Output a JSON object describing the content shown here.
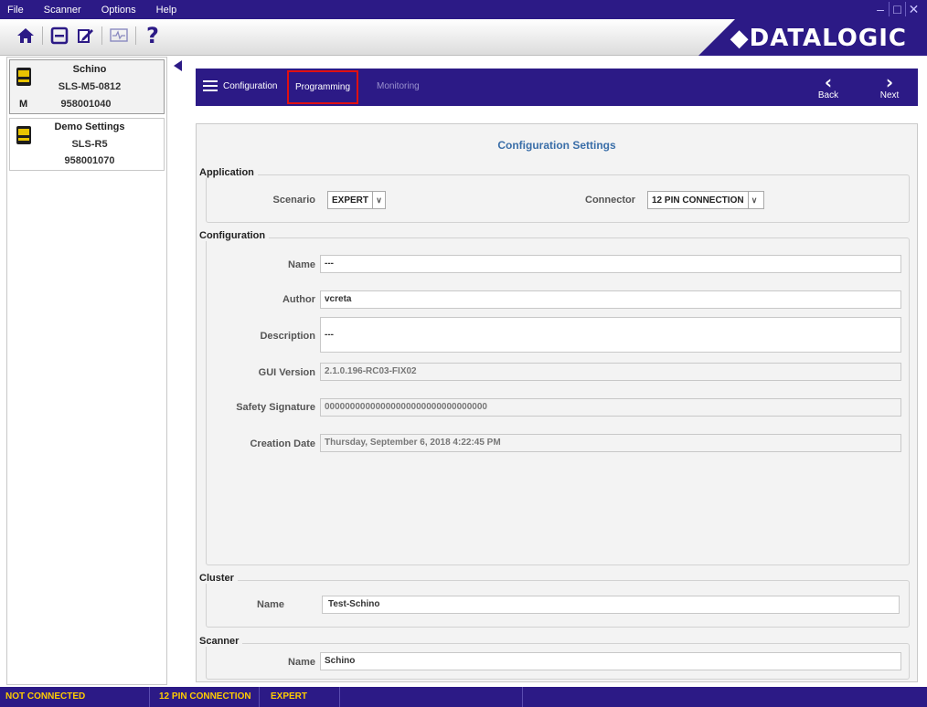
{
  "menu": [
    "File",
    "Scanner",
    "Options",
    "Help"
  ],
  "window_controls": {
    "minimize": "–",
    "maximize": "□",
    "close": "✕"
  },
  "toolbar": {
    "help_label": "?"
  },
  "brand": {
    "name": "◆DATALOGIC"
  },
  "devices": [
    {
      "name": "Schino",
      "model": "SLS-M5-0812",
      "badge": "M",
      "serial": "958001040"
    },
    {
      "name": "Demo Settings",
      "model": "SLS-R5",
      "serial": "958001070"
    }
  ],
  "nav": {
    "configuration": "Configuration",
    "programming": "Programming",
    "monitoring": "Monitoring",
    "back": "Back",
    "next": "Next",
    "back_glyph": "‹",
    "next_glyph": "›"
  },
  "panel": {
    "title": "Configuration Settings",
    "application": {
      "label": "Application",
      "scenario_label": "Scenario",
      "scenario_value": "EXPERT",
      "connector_label": "Connector",
      "connector_value": "12 PIN CONNECTION"
    },
    "configuration": {
      "label": "Configuration",
      "name_label": "Name",
      "name_value": "---",
      "author_label": "Author",
      "author_value": "vcreta",
      "description_label": "Description",
      "description_value": "---",
      "gui_version_label": "GUI Version",
      "gui_version_value": "2.1.0.196-RC03-FIX02",
      "safety_signature_label": "Safety Signature",
      "safety_signature_value": "00000000000000000000000000000000",
      "creation_date_label": "Creation Date",
      "creation_date_value": "Thursday, September 6, 2018 4:22:45 PM"
    },
    "cluster": {
      "label": "Cluster",
      "name_label": "Name",
      "name_value": "Test-Schino"
    },
    "scanner": {
      "label": "Scanner",
      "name_label": "Name",
      "name_value": "Schino"
    }
  },
  "status": {
    "connection": "NOT CONNECTED",
    "connector": "12 PIN CONNECTION",
    "scenario": "EXPERT"
  },
  "colors": {
    "brand_purple": "#2c1a86",
    "status_text": "#ffcc00",
    "title_blue": "#3a6ea8",
    "highlight_red": "#e01010"
  }
}
